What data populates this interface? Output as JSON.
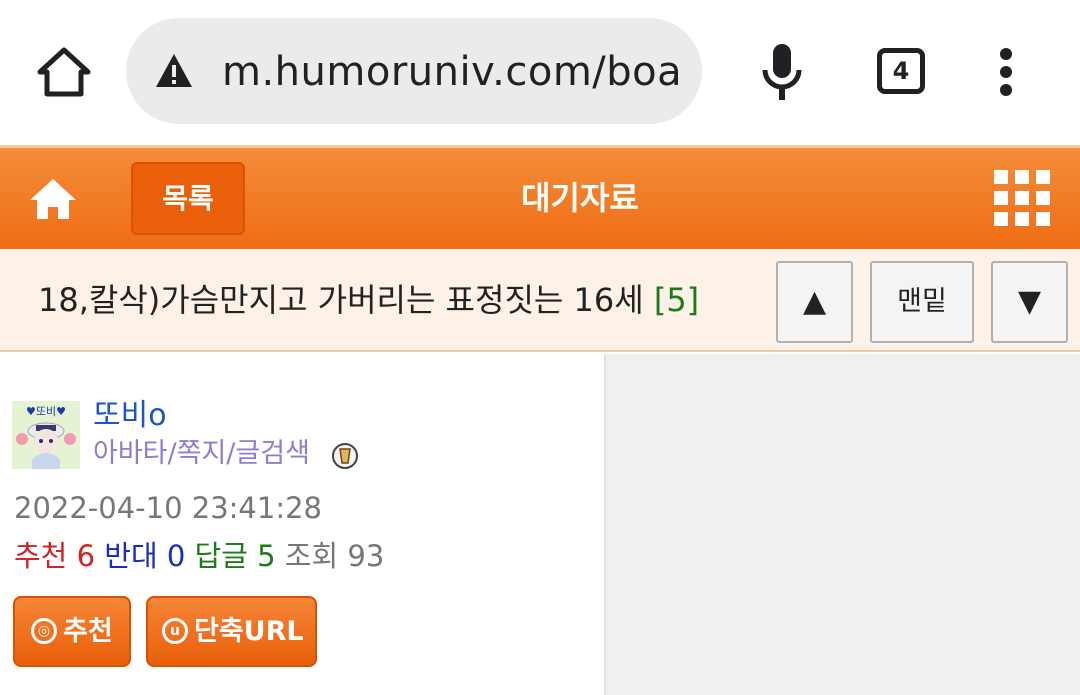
{
  "browser": {
    "url": "m.humoruniv.com/boa",
    "tab_count": "4"
  },
  "header": {
    "list_label": "목록",
    "title": "대기자료"
  },
  "post": {
    "title": "18,칼삭)가슴만지고 가버리는 표정짓는 16세",
    "reply_count": "[5]",
    "nav": {
      "up": "▲",
      "bottom": "맨밑",
      "down": "▼"
    }
  },
  "author": {
    "name": "또비o",
    "links": "아바타/쪽지/글검색",
    "avatar_text": "♥또비♥"
  },
  "meta": {
    "date": "2022-04-10 23:41:28",
    "recommend_label": "추천",
    "recommend_value": "6",
    "oppose_label": "반대",
    "oppose_value": "0",
    "reply_label": "답글",
    "reply_value": "5",
    "views_label": "조회",
    "views_value": "93"
  },
  "actions": {
    "recommend_icon": "◎",
    "recommend_label": "추천",
    "short_url_icon": "u",
    "short_url_label": "단축URL"
  },
  "colors": {
    "header_orange": "#ef6c13",
    "button_orange": "#ea5f0a",
    "author_blue": "#1a56c4",
    "recommend_red": "#d42323",
    "oppose_blue": "#1a2bc4",
    "reply_green": "#1a7d1a"
  }
}
